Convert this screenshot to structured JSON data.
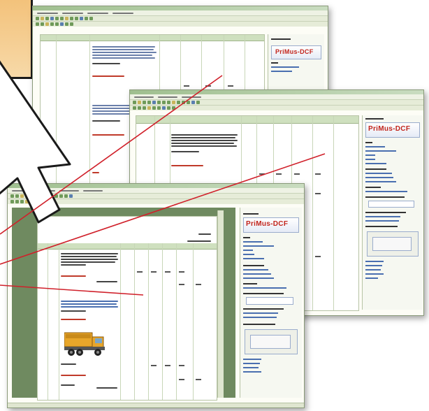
{
  "logo_text": "PriMus-DCF",
  "colors": {
    "accent_green": "#6f9a5a",
    "logo_red": "#c2241b",
    "callout_line_red": "#d0202a",
    "background_orange": "#f3c27b"
  },
  "windows": [
    {
      "name": "back-window"
    },
    {
      "name": "middle-window"
    },
    {
      "name": "front-window"
    }
  ],
  "icons": [
    "mouse-cursor-icon",
    "truck-image"
  ]
}
